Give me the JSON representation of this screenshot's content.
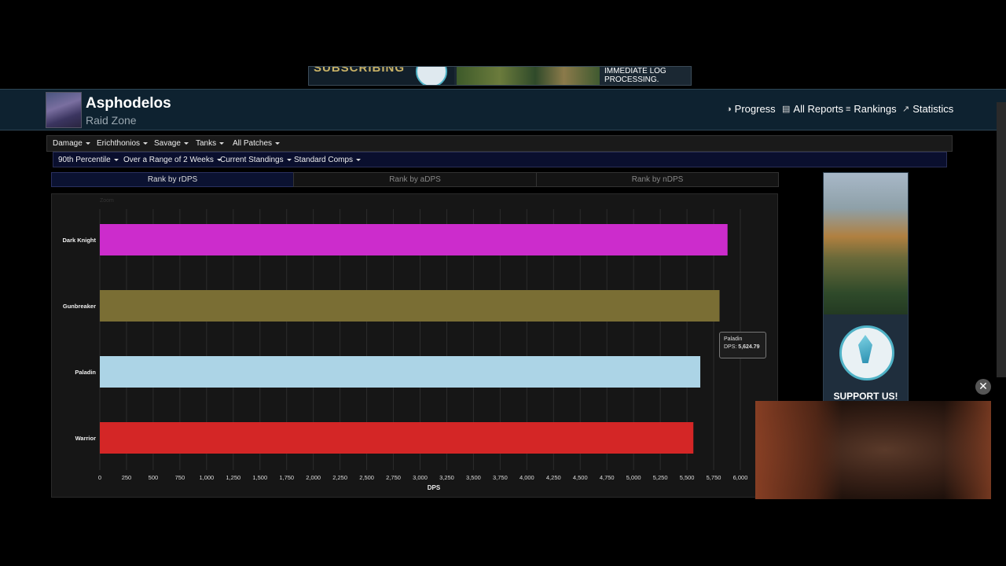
{
  "top_ad": {
    "left_text": "SUBSCRIBING",
    "right_line1": "IMMEDIATE LOG",
    "right_line2": "PROCESSING."
  },
  "header": {
    "title": "Asphodelos",
    "subtitle": "Raid Zone",
    "nav": [
      {
        "label": "Progress",
        "icon": "globe-icon",
        "glyph": "◑"
      },
      {
        "label": "All Reports",
        "icon": "reports-icon",
        "glyph": "▤"
      },
      {
        "label": "Rankings",
        "icon": "rankings-icon",
        "glyph": "≡"
      },
      {
        "label": "Statistics",
        "icon": "statistics-icon",
        "glyph": "↗"
      }
    ]
  },
  "filters_row1": [
    "Damage",
    "Erichthonios",
    "Savage",
    "Tanks",
    "All Patches"
  ],
  "filters_row2": [
    "90th Percentile",
    "Over a Range of 2 Weeks",
    "Current Standings",
    "Standard Comps"
  ],
  "tabs": [
    {
      "label": "Rank by rDPS",
      "active": true
    },
    {
      "label": "Rank by aDPS",
      "active": false
    },
    {
      "label": "Rank by nDPS",
      "active": false
    }
  ],
  "tooltip": {
    "name": "Paladin",
    "dps_label": "DPS:",
    "dps_value": "5,624.79"
  },
  "side_ad": {
    "support_text": "SUPPORT US!"
  },
  "video": {
    "close_glyph": "✕"
  },
  "colors": {
    "header_bg": "#0e2230",
    "filter2_bg": "#0a0f2e",
    "active_tab_bg": "#0b1231"
  },
  "chart_data": {
    "type": "bar",
    "orientation": "horizontal",
    "corner_label": "Zoom",
    "categories": [
      "Dark Knight",
      "Gunbreaker",
      "Paladin",
      "Warrior"
    ],
    "values": [
      5880,
      5805,
      5624.79,
      5560
    ],
    "colors": [
      "#cc2ccc",
      "#7a6e34",
      "#acd4e6",
      "#d42626"
    ],
    "xlabel": "DPS",
    "xlim": [
      0,
      6000
    ],
    "xticks": [
      "0",
      "250",
      "500",
      "750",
      "1,000",
      "1,250",
      "1,500",
      "1,750",
      "2,000",
      "2,250",
      "2,500",
      "2,750",
      "3,000",
      "3,250",
      "3,500",
      "3,750",
      "4,000",
      "4,250",
      "4,500",
      "4,750",
      "5,000",
      "5,250",
      "5,500",
      "5,750",
      "6,000"
    ],
    "grid": true
  }
}
